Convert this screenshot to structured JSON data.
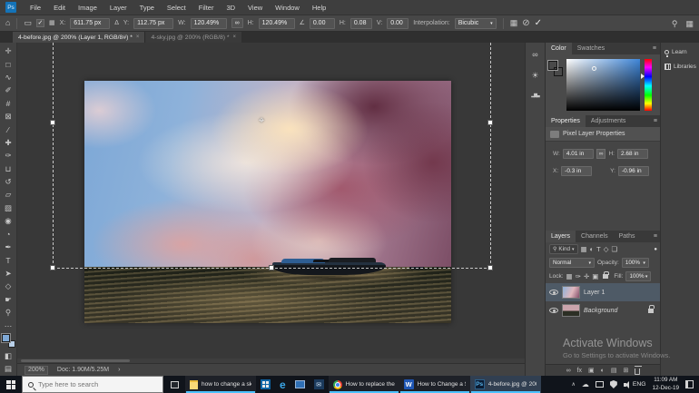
{
  "colors": {
    "foreground_swatch": "#7fa9d6",
    "background_swatch": "#b9d0e8",
    "layer_selection": "#4e5a66",
    "taskbar_underline": "#4cc2ff",
    "sat_box_hue": "#3f86d8"
  },
  "menu_bar": {
    "logo": "Ps",
    "items": [
      "File",
      "Edit",
      "Image",
      "Layer",
      "Type",
      "Select",
      "Filter",
      "3D",
      "View",
      "Window",
      "Help"
    ]
  },
  "options_bar": {
    "x_label": "X:",
    "x_value": "611.75 px",
    "delta_glyph": "Δ",
    "y_label": "Y:",
    "y_value": "112.75 px",
    "w_label": "W:",
    "w_value": "120.49%",
    "h_label": "H:",
    "h_value": "120.49%",
    "rotate_value": "0.00",
    "h_skew_label": "H:",
    "h_skew_value": "0.08",
    "v_skew_label": "V:",
    "v_skew_value": "0.00",
    "interpolation_label": "Interpolation:",
    "interpolation_value": "Bicubic"
  },
  "icons": {
    "home": "⌂",
    "transform_badge": "▭",
    "check": "✓",
    "ref_grid": "▦",
    "link": "∞",
    "angle": "∠",
    "dropdown": "▾",
    "warp": "▦",
    "cancel": "⊘",
    "commit": "✓",
    "search": "⚲",
    "workspace": "▦",
    "panel_menu": "≡",
    "strip_circles": "∞",
    "strip_sun": "☀",
    "strip_histogram": "▂▆▃",
    "status_chevron": "›",
    "tray_chevron": "∧",
    "tray_cloud": "☁",
    "mail_glyph": "✉"
  },
  "document_tabs": [
    {
      "label": "4-before.jpg @ 200% (Layer 1, RGB/8#) *",
      "close": "×"
    },
    {
      "label": "4-sky.jpg @ 200% (RGB/8) *",
      "close": "×"
    }
  ],
  "toolbar": {
    "tools": [
      {
        "name": "move-tool",
        "glyph": "✛"
      },
      {
        "name": "rectangular-marquee-tool",
        "glyph": "□"
      },
      {
        "name": "lasso-tool",
        "glyph": "∿"
      },
      {
        "name": "quick-selection-tool",
        "glyph": "✐"
      },
      {
        "name": "crop-tool",
        "glyph": "#"
      },
      {
        "name": "frame-tool",
        "glyph": "⊠"
      },
      {
        "name": "eyedropper-tool",
        "glyph": "∕"
      },
      {
        "name": "spot-healing-brush-tool",
        "glyph": "✚"
      },
      {
        "name": "brush-tool",
        "glyph": "✑"
      },
      {
        "name": "clone-stamp-tool",
        "glyph": "⊔"
      },
      {
        "name": "history-brush-tool",
        "glyph": "↺"
      },
      {
        "name": "eraser-tool",
        "glyph": "▱"
      },
      {
        "name": "gradient-tool",
        "glyph": "▨"
      },
      {
        "name": "blur-tool",
        "glyph": "◉"
      },
      {
        "name": "dodge-tool",
        "glyph": "◔"
      },
      {
        "name": "pen-tool",
        "glyph": "✒"
      },
      {
        "name": "type-tool",
        "glyph": "T"
      },
      {
        "name": "path-selection-tool",
        "glyph": "➤"
      },
      {
        "name": "shape-tool",
        "glyph": "◇"
      },
      {
        "name": "hand-tool",
        "glyph": "☛"
      },
      {
        "name": "zoom-tool",
        "glyph": "⚲"
      },
      {
        "name": "edit-toolbar",
        "glyph": "⋯"
      },
      {
        "name": "quick-mask-mode",
        "glyph": "◧"
      },
      {
        "name": "screen-mode",
        "glyph": "▤"
      }
    ]
  },
  "status_bar": {
    "zoom": "200%",
    "doc_sizes": "Doc: 1.90M/5.25M"
  },
  "panels": {
    "color": {
      "tab_color": "Color",
      "tab_swatches": "Swatches"
    },
    "properties": {
      "tab_properties": "Properties",
      "tab_adjustments": "Adjustments",
      "header": "Pixel Layer Properties",
      "w_label": "W:",
      "w_value": "4.01 in",
      "h_label": "H:",
      "h_value": "2.68 in",
      "x_label": "X:",
      "x_value": "-0.3 in",
      "y_label": "Y:",
      "y_value": "-0.96 in"
    },
    "layers": {
      "tab_layers": "Layers",
      "tab_channels": "Channels",
      "tab_paths": "Paths",
      "kind_label": "Kind",
      "filter_icons": [
        {
          "name": "filter-pixel-layers-icon",
          "glyph": "▦"
        },
        {
          "name": "filter-adjustment-layers-icon",
          "glyph": "◐"
        },
        {
          "name": "filter-type-layers-icon",
          "glyph": "T"
        },
        {
          "name": "filter-shape-layers-icon",
          "glyph": "◇"
        },
        {
          "name": "filter-smart-objects-icon",
          "glyph": "❏"
        }
      ],
      "filter_toggle_glyph": "●",
      "blend_mode": "Normal",
      "opacity_label": "Opacity:",
      "opacity_value": "100%",
      "lock_label": "Lock:",
      "lock_icons": [
        {
          "name": "lock-transparent-pixels-icon",
          "glyph": "▦"
        },
        {
          "name": "lock-image-pixels-icon",
          "glyph": "✑"
        },
        {
          "name": "lock-position-icon",
          "glyph": "✛"
        },
        {
          "name": "lock-artboard-icon",
          "glyph": "▣"
        }
      ],
      "fill_label": "Fill:",
      "fill_value": "100%",
      "items": [
        {
          "name": "Layer 1",
          "selected": true,
          "locked": false,
          "thumb": "sky"
        },
        {
          "name": "Background",
          "selected": false,
          "locked": true,
          "thumb": "bgimg"
        }
      ],
      "bottom_icons": [
        {
          "name": "link-layers-icon",
          "glyph": "∞"
        },
        {
          "name": "layer-style-icon",
          "glyph": "fx"
        },
        {
          "name": "layer-mask-icon",
          "glyph": "▣"
        },
        {
          "name": "adjustment-layer-icon",
          "glyph": "◐"
        },
        {
          "name": "new-group-icon",
          "glyph": "▤"
        },
        {
          "name": "new-layer-icon",
          "glyph": "⊞"
        }
      ]
    },
    "dock": {
      "learn": "Learn",
      "libraries": "Libraries"
    }
  },
  "watermark": {
    "line1": "Activate Windows",
    "line2": "Go to Settings to activate Windows."
  },
  "taskbar": {
    "search_placeholder": "Type here to search",
    "apps": [
      {
        "kind": "notes",
        "label": "how to change a sk...",
        "open": true,
        "active": false
      },
      {
        "kind": "store",
        "label": "",
        "open": false,
        "active": false
      },
      {
        "kind": "edge",
        "label": "",
        "open": false,
        "active": false
      },
      {
        "kind": "monitor",
        "label": "",
        "open": false,
        "active": false
      },
      {
        "kind": "mail",
        "label": "",
        "open": false,
        "active": false
      },
      {
        "kind": "chrome",
        "label": "How to replace the ...",
        "open": true,
        "active": false
      },
      {
        "kind": "word",
        "label": "How to Change a S...",
        "open": true,
        "active": false
      },
      {
        "kind": "photoshop",
        "label": "4-before.jpg @ 200...",
        "open": true,
        "active": true
      }
    ],
    "tray": {
      "language": "ENG",
      "time": "11:09 AM",
      "date": "12-Dec-19"
    }
  }
}
